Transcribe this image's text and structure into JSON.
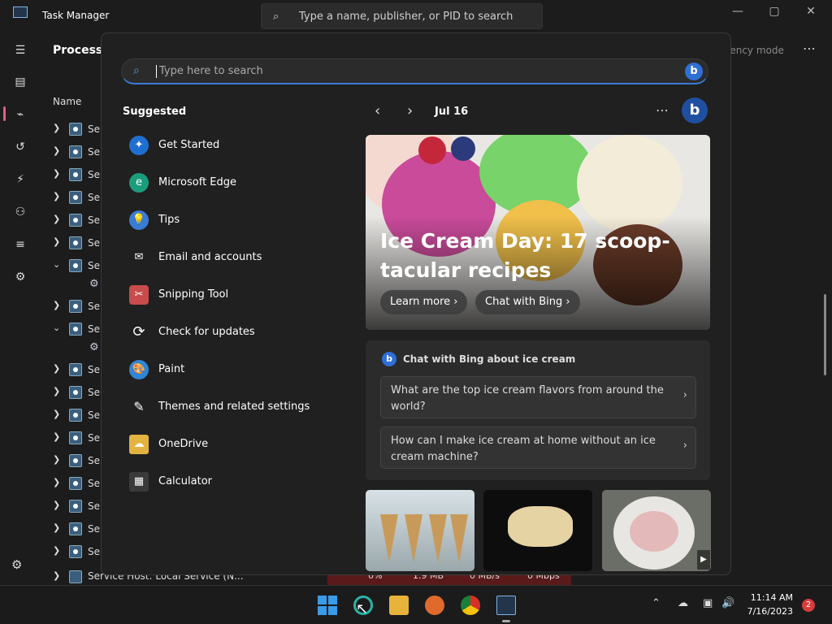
{
  "task_manager": {
    "title": "Task Manager",
    "search_placeholder": "Type a name, publisher, or PID to search",
    "window_controls": [
      "—",
      "▢",
      "✕"
    ],
    "section_title": "Processes",
    "efficiency_mode_label": "iency mode",
    "name_column": "Name",
    "row_label": "Ser",
    "bottom_row_label": "Service Host: Local Service (N...",
    "stats": {
      "cpu": "0%",
      "memory": "1.9 MB",
      "disk": "0 MB/s",
      "network": "0 Mbps"
    }
  },
  "panel": {
    "search_placeholder": "Type here to search",
    "suggested_title": "Suggested",
    "suggested": [
      {
        "label": "Get Started",
        "icon": "get-started-icon",
        "color": "#1f6fd1"
      },
      {
        "label": "Microsoft Edge",
        "icon": "edge-icon",
        "color": "#1a9d7a"
      },
      {
        "label": "Tips",
        "icon": "tips-icon",
        "color": "#3a7bd5"
      },
      {
        "label": "Email and accounts",
        "icon": "mail-icon",
        "color": "#2a2a2a"
      },
      {
        "label": "Snipping Tool",
        "icon": "snipping-icon",
        "color": "#c94b4b"
      },
      {
        "label": "Check for updates",
        "icon": "refresh-icon",
        "color": "#2a2a2a"
      },
      {
        "label": "Paint",
        "icon": "paint-icon",
        "color": "#2f86d6"
      },
      {
        "label": "Themes and related settings",
        "icon": "brush-icon",
        "color": "#2a2a2a"
      },
      {
        "label": "OneDrive",
        "icon": "onedrive-icon",
        "color": "#e3b341"
      },
      {
        "label": "Calculator",
        "icon": "calculator-icon",
        "color": "#3a3a3a"
      }
    ],
    "date": "Jul 16",
    "hero": {
      "title": "Ice Cream Day: 17 scoop-tacular recipes",
      "learn_more": "Learn more",
      "chat_with_bing": "Chat with Bing"
    },
    "chat": {
      "title": "Chat with Bing about ice cream",
      "questions": [
        "What are the top ice cream flavors from around the world?",
        "How can I make ice cream at home without an ice cream machine?"
      ]
    }
  },
  "taskbar": {
    "time": "11:14 AM",
    "date": "7/16/2023",
    "notification_count": "2"
  }
}
